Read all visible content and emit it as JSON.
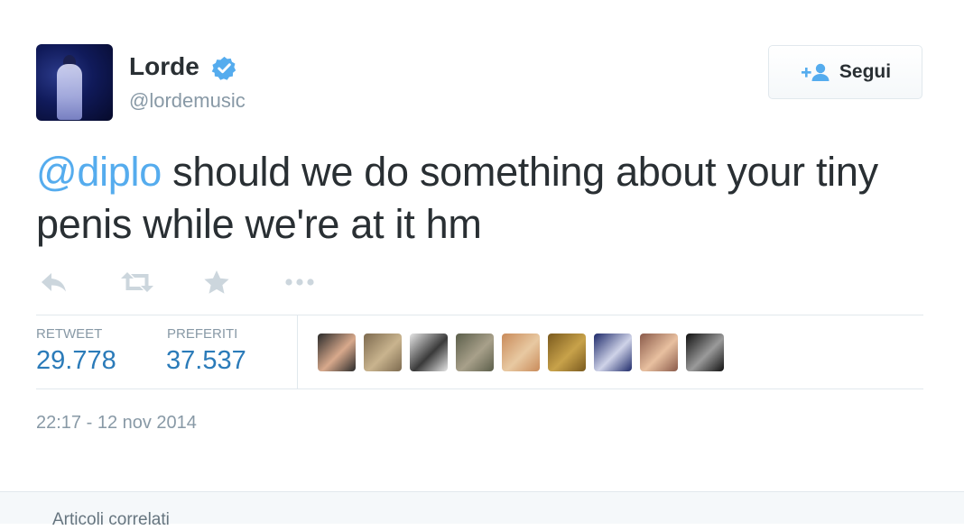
{
  "author": {
    "name": "Lorde",
    "handle": "@lordemusic",
    "verified": true
  },
  "follow_button": {
    "label": "Segui",
    "icon": "add-user-icon"
  },
  "tweet": {
    "mention": "@diplo",
    "text": " should we do something about your tiny penis while we're at it hm"
  },
  "actions": [
    {
      "name": "reply-icon"
    },
    {
      "name": "retweet-icon"
    },
    {
      "name": "favorite-star-icon"
    },
    {
      "name": "more-icon"
    }
  ],
  "stats": {
    "retweets": {
      "label": "RETWEET",
      "value": "29.778"
    },
    "favorites": {
      "label": "PREFERITI",
      "value": "37.537"
    }
  },
  "favoriters": [
    {
      "name": "favoriter-avatar-1",
      "c1": "#2a2a2a",
      "c2": "#d8a98c"
    },
    {
      "name": "favoriter-avatar-2",
      "c1": "#7d6a4f",
      "c2": "#c9b48e"
    },
    {
      "name": "favoriter-avatar-3",
      "c1": "#e6e6e6",
      "c2": "#3a3a3a"
    },
    {
      "name": "favoriter-avatar-4",
      "c1": "#5b5e4a",
      "c2": "#a8a08a"
    },
    {
      "name": "favoriter-avatar-5",
      "c1": "#c98b5a",
      "c2": "#e8c9a2"
    },
    {
      "name": "favoriter-avatar-6",
      "c1": "#7a5a1e",
      "c2": "#c8a24a"
    },
    {
      "name": "favoriter-avatar-7",
      "c1": "#1e2a6a",
      "c2": "#cfd3e8"
    },
    {
      "name": "favoriter-avatar-8",
      "c1": "#8a5a4a",
      "c2": "#e8c0a0"
    },
    {
      "name": "favoriter-avatar-9",
      "c1": "#111111",
      "c2": "#9a9a9a"
    }
  ],
  "timestamp": "22:17 - 12 nov 2014",
  "related": {
    "title": "Articoli correlati"
  },
  "colors": {
    "link": "#55acee",
    "stat": "#2b7bb9",
    "muted": "#8899a6",
    "verified": "#55acee"
  }
}
